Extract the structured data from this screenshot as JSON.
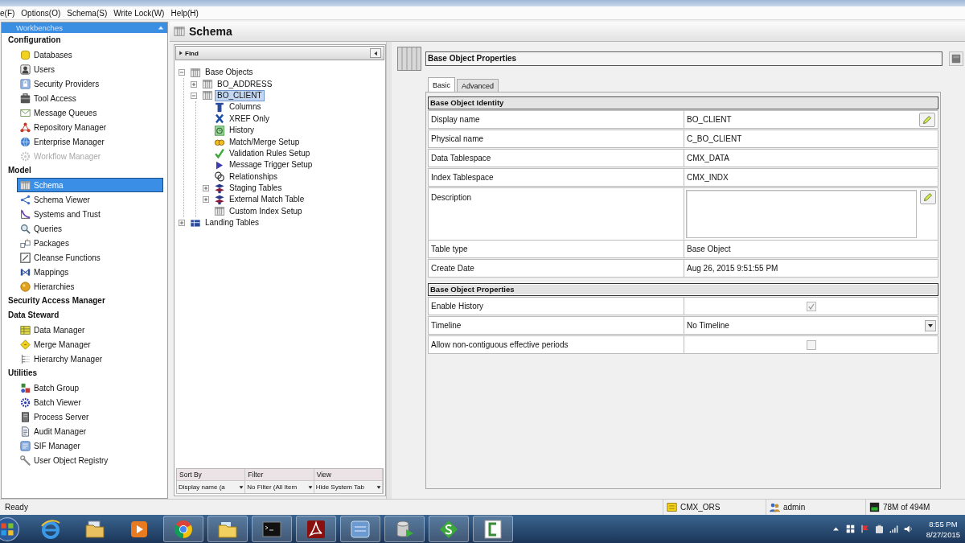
{
  "menu_bar": {
    "items": [
      "e(F)",
      "Options(O)",
      "Schema(S)",
      "Write Lock(W)",
      "Help(H)"
    ]
  },
  "workbenches": {
    "title": "Workbenches",
    "groups": [
      {
        "label": "Configuration",
        "items": [
          {
            "label": "Databases",
            "selected": false,
            "disabled": false
          },
          {
            "label": "Users",
            "selected": false,
            "disabled": false
          },
          {
            "label": "Security Providers",
            "selected": false,
            "disabled": false
          },
          {
            "label": "Tool Access",
            "selected": false,
            "disabled": false
          },
          {
            "label": "Message Queues",
            "selected": false,
            "disabled": false
          },
          {
            "label": "Repository Manager",
            "selected": false,
            "disabled": false
          },
          {
            "label": "Enterprise Manager",
            "selected": false,
            "disabled": false
          },
          {
            "label": "Workflow Manager",
            "selected": false,
            "disabled": true
          }
        ]
      },
      {
        "label": "Model",
        "items": [
          {
            "label": "Schema",
            "selected": true,
            "disabled": false
          },
          {
            "label": "Schema Viewer",
            "selected": false,
            "disabled": false
          },
          {
            "label": "Systems and Trust",
            "selected": false,
            "disabled": false
          },
          {
            "label": "Queries",
            "selected": false,
            "disabled": false
          },
          {
            "label": "Packages",
            "selected": false,
            "disabled": false
          },
          {
            "label": "Cleanse Functions",
            "selected": false,
            "disabled": false
          },
          {
            "label": "Mappings",
            "selected": false,
            "disabled": false
          },
          {
            "label": "Hierarchies",
            "selected": false,
            "disabled": false
          }
        ]
      },
      {
        "label": "Security Access Manager"
      },
      {
        "label": "Data Steward",
        "items": [
          {
            "label": "Data Manager",
            "selected": false,
            "disabled": false
          },
          {
            "label": "Merge Manager",
            "selected": false,
            "disabled": false
          },
          {
            "label": "Hierarchy Manager",
            "selected": false,
            "disabled": false
          }
        ]
      },
      {
        "label": "Utilities",
        "items": [
          {
            "label": "Batch Group",
            "selected": false,
            "disabled": false
          },
          {
            "label": "Batch Viewer",
            "selected": false,
            "disabled": false
          },
          {
            "label": "Process Server",
            "selected": false,
            "disabled": false
          },
          {
            "label": "Audit Manager",
            "selected": false,
            "disabled": false
          },
          {
            "label": "SIF Manager",
            "selected": false,
            "disabled": false
          },
          {
            "label": "User Object Registry",
            "selected": false,
            "disabled": false
          }
        ]
      }
    ]
  },
  "schema_header": {
    "title": "Schema"
  },
  "tree_panel": {
    "find_label": "Find",
    "tree": [
      {
        "label": "Base Objects",
        "expanded": true,
        "selected": false,
        "children": [
          {
            "label": "BO_ADDRESS",
            "expanded": false,
            "selected": false
          },
          {
            "label": "BO_CLIENT",
            "expanded": true,
            "selected": true,
            "children": [
              {
                "label": "Columns",
                "selected": false
              },
              {
                "label": "XREF Only",
                "selected": false
              },
              {
                "label": "History",
                "selected": false
              },
              {
                "label": "Match/Merge Setup",
                "selected": false
              },
              {
                "label": "Validation Rules Setup",
                "selected": false
              },
              {
                "label": "Message Trigger Setup",
                "selected": false
              },
              {
                "label": "Relationships",
                "selected": false
              },
              {
                "label": "Staging Tables",
                "expanded": false,
                "selected": false
              },
              {
                "label": "External Match Table",
                "expanded": false,
                "selected": false
              },
              {
                "label": "Custom Index Setup",
                "selected": false
              }
            ]
          }
        ]
      },
      {
        "label": "Landing Tables",
        "expanded": false,
        "selected": false
      }
    ],
    "footer": [
      {
        "heading": "Sort By",
        "value": "Display name (a"
      },
      {
        "heading": "Filter",
        "value": "No Filter (All Item"
      },
      {
        "heading": "View",
        "value": "Hide System Tab"
      }
    ]
  },
  "properties": {
    "title": "Base Object Properties",
    "tabs": [
      {
        "label": "Basic",
        "selected": true
      },
      {
        "label": "Advanced",
        "selected": false
      }
    ],
    "sections": [
      {
        "title": "Base Object Identity",
        "rows": [
          {
            "kind": "text",
            "label": "Display name",
            "value": "BO_CLIENT",
            "editable": true
          },
          {
            "kind": "text",
            "label": "Physical name",
            "value": "C_BO_CLIENT",
            "editable": false
          },
          {
            "kind": "text",
            "label": "Data Tablespace",
            "value": "CMX_DATA",
            "editable": false
          },
          {
            "kind": "text",
            "label": "Index Tablespace",
            "value": "CMX_INDX",
            "editable": false
          },
          {
            "kind": "textarea",
            "label": "Description",
            "editable": true
          },
          {
            "kind": "text",
            "label": "Table type",
            "value": "Base Object",
            "editable": false
          },
          {
            "kind": "text",
            "label": "Create Date",
            "value": "Aug 26, 2015 9:51:55 PM",
            "editable": false
          }
        ]
      },
      {
        "title": "Base Object Properties",
        "rows": [
          {
            "kind": "checkbox",
            "label": "Enable History",
            "checked": true,
            "disabled": true
          },
          {
            "kind": "dropdown",
            "label": "Timeline",
            "value": "No Timeline"
          },
          {
            "kind": "checkbox",
            "label": "Allow non-contiguous effective periods",
            "checked": false,
            "disabled": true
          }
        ]
      }
    ]
  },
  "status_bar": {
    "message": "Ready",
    "items": [
      "CMX_ORS",
      "admin",
      "78M of 494M"
    ]
  },
  "taskbar": {
    "apps": [
      {
        "running": false
      },
      {
        "running": false
      },
      {
        "running": false
      },
      {
        "running": true
      },
      {
        "running": true
      },
      {
        "running": true
      },
      {
        "running": true
      },
      {
        "running": true
      },
      {
        "running": true
      },
      {
        "running": true
      },
      {
        "running": true
      }
    ],
    "clock": {
      "time": "8:55 PM",
      "date": "8/27/2015"
    }
  }
}
